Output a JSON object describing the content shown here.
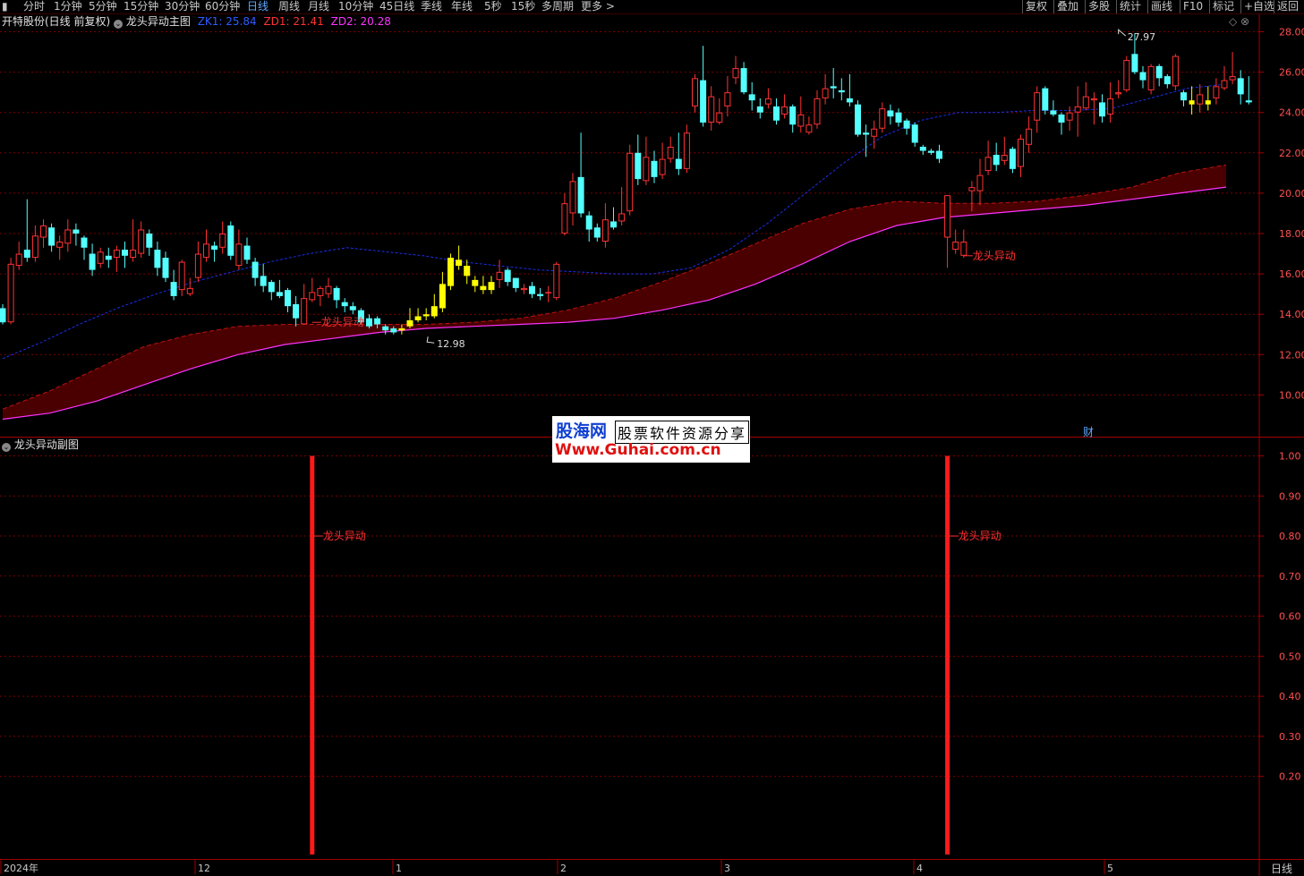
{
  "toolbar": {
    "periods": [
      "分时",
      "1分钟",
      "5分钟",
      "15分钟",
      "30分钟",
      "60分钟",
      "日线",
      "周线",
      "月线",
      "10分钟",
      "45日线",
      "季线",
      "年线",
      "5秒",
      "15秒",
      "多周期",
      "更多 >"
    ],
    "active_period": "日线",
    "right_buttons": [
      "复权",
      "叠加",
      "多股",
      "统计",
      "画线",
      "F10",
      "标记",
      "+自选",
      "返回"
    ]
  },
  "main_panel": {
    "stock_label": "开特股份(日线 前复权)",
    "indicator_name": "龙头异动主图",
    "zk1_label": "ZK1: 25.84",
    "zd1_label": "ZD1: 21.41",
    "zd2_label": "ZD2: 20.28",
    "high_annotation": "27.97",
    "low_annotation": "12.98",
    "signal_label": "龙头异动",
    "finance_marker": "财"
  },
  "sub_panel": {
    "indicator_name": "龙头异动副图",
    "signal_label": "龙头异动"
  },
  "watermark": {
    "site_cn": "股海网",
    "slogan": "股票软件资源分享",
    "url": "Www.Guhai.com.cn"
  },
  "x_axis": {
    "labels": [
      "2024年",
      "12",
      "1",
      "2",
      "3",
      "4",
      "5"
    ],
    "period_label": "日线"
  },
  "colors": {
    "up": "#ff3232",
    "down": "#54ffff",
    "signal": "#ffff00",
    "ma_line": "#1a2ee8",
    "band_fill": "#4a0000",
    "band_lower": "#ff33ff",
    "grid": "#7a0000",
    "signal_bar": "#ff1a1a"
  },
  "chart_data": [
    {
      "type": "candlestick",
      "title": "龙头异动主图",
      "ylim": [
        8.5,
        28.5
      ],
      "y_ticks": [
        "28.00",
        "26.00",
        "24.00",
        "22.00",
        "20.00",
        "18.00",
        "16.00",
        "14.00",
        "12.00",
        "10.00"
      ],
      "candles": [
        [
          14.3,
          13.6,
          14.5,
          13.5
        ],
        [
          13.6,
          16.5,
          16.8,
          13.5
        ],
        [
          16.4,
          17.0,
          17.6,
          16.2
        ],
        [
          17.2,
          16.8,
          19.7,
          16.6
        ],
        [
          16.8,
          17.9,
          18.4,
          16.6
        ],
        [
          17.8,
          18.4,
          18.7,
          17.3
        ],
        [
          18.3,
          17.4,
          18.5,
          17.1
        ],
        [
          17.3,
          17.6,
          17.9,
          16.7
        ],
        [
          17.5,
          18.2,
          18.7,
          17.1
        ],
        [
          18.2,
          18.0,
          18.5,
          17.4
        ],
        [
          17.8,
          17.3,
          17.9,
          16.7
        ],
        [
          17.0,
          16.2,
          17.5,
          15.9
        ],
        [
          16.5,
          17.1,
          17.3,
          16.3
        ],
        [
          16.9,
          16.7,
          17.3,
          16.3
        ],
        [
          16.8,
          17.2,
          17.4,
          16.1
        ],
        [
          17.2,
          16.9,
          17.6,
          16.3
        ],
        [
          16.8,
          17.2,
          18.7,
          16.6
        ],
        [
          17.0,
          18.2,
          18.6,
          16.8
        ],
        [
          18.0,
          17.3,
          18.2,
          16.9
        ],
        [
          17.2,
          16.3,
          17.6,
          15.9
        ],
        [
          16.8,
          15.8,
          17.1,
          15.6
        ],
        [
          15.6,
          14.9,
          16.2,
          14.7
        ],
        [
          15.2,
          16.6,
          16.7,
          14.9
        ],
        [
          15.0,
          15.3,
          15.8,
          14.9
        ],
        [
          15.8,
          17.0,
          17.6,
          15.6
        ],
        [
          16.8,
          17.5,
          18.2,
          16.6
        ],
        [
          17.4,
          17.2,
          17.6,
          16.6
        ],
        [
          17.3,
          18.0,
          18.6,
          17.0
        ],
        [
          18.4,
          16.9,
          18.6,
          16.7
        ],
        [
          16.4,
          17.5,
          18.2,
          16.2
        ],
        [
          17.4,
          16.7,
          17.8,
          16.5
        ],
        [
          16.6,
          15.8,
          16.8,
          15.4
        ],
        [
          15.9,
          15.4,
          16.5,
          15.1
        ],
        [
          15.6,
          15.1,
          15.7,
          14.7
        ],
        [
          15.1,
          14.9,
          15.7,
          14.8
        ],
        [
          15.2,
          14.4,
          15.3,
          14.1
        ],
        [
          14.5,
          13.8,
          14.9,
          13.4
        ],
        [
          13.5,
          14.8,
          15.5,
          13.5
        ],
        [
          14.7,
          15.1,
          15.8,
          14.6
        ],
        [
          14.9,
          15.3,
          15.4,
          14.4
        ],
        [
          15.0,
          15.4,
          15.8,
          14.8
        ],
        [
          15.3,
          14.7,
          15.4,
          14.3
        ],
        [
          14.6,
          14.4,
          14.8,
          14.1
        ],
        [
          14.4,
          14.2,
          14.6,
          14.0
        ],
        [
          14.2,
          13.6,
          14.3,
          13.5
        ],
        [
          13.8,
          13.4,
          14.0,
          13.3
        ],
        [
          13.8,
          13.5,
          13.9,
          13.3
        ],
        [
          13.4,
          13.2,
          13.5,
          13.0
        ],
        [
          13.3,
          13.1,
          13.4,
          13.0
        ],
        [
          13.2,
          13.3,
          13.5,
          13.0
        ],
        [
          13.4,
          13.7,
          14.3,
          13.3
        ],
        [
          13.7,
          13.9,
          14.3,
          13.6
        ],
        [
          13.9,
          14.0,
          14.3,
          13.7
        ],
        [
          13.9,
          14.4,
          15.0,
          13.8
        ],
        [
          14.3,
          15.5,
          16.1,
          14.1
        ],
        [
          15.4,
          16.8,
          17.0,
          15.2
        ],
        [
          16.7,
          16.4,
          17.4,
          16.2
        ],
        [
          16.4,
          15.9,
          16.7,
          15.5
        ],
        [
          15.7,
          15.4,
          15.9,
          15.1
        ],
        [
          15.4,
          15.2,
          15.9,
          15.0
        ],
        [
          15.2,
          15.6,
          15.9,
          15.0
        ],
        [
          15.7,
          16.1,
          16.7,
          15.3
        ],
        [
          16.2,
          15.6,
          16.3,
          15.4
        ],
        [
          15.8,
          15.3,
          15.8,
          15.1
        ],
        [
          15.2,
          15.3,
          15.5,
          15.0
        ],
        [
          15.4,
          15.0,
          15.6,
          14.8
        ],
        [
          15.0,
          14.9,
          15.3,
          14.7
        ],
        [
          15.1,
          15.1,
          15.4,
          14.6
        ],
        [
          14.8,
          16.5,
          16.6,
          14.7
        ],
        [
          18.0,
          19.5,
          20.0,
          17.9
        ],
        [
          19.0,
          20.6,
          21.0,
          18.4
        ],
        [
          20.8,
          19.0,
          23.0,
          18.8
        ],
        [
          18.9,
          18.2,
          19.1,
          17.6
        ],
        [
          18.3,
          17.8,
          18.5,
          17.6
        ],
        [
          17.6,
          18.7,
          19.5,
          17.3
        ],
        [
          18.6,
          18.3,
          19.3,
          18.2
        ],
        [
          18.6,
          19.0,
          20.3,
          18.4
        ],
        [
          19.1,
          22.0,
          22.4,
          18.9
        ],
        [
          22.0,
          20.7,
          22.9,
          20.4
        ],
        [
          20.6,
          21.8,
          22.8,
          20.4
        ],
        [
          21.6,
          20.8,
          22.1,
          20.5
        ],
        [
          20.9,
          21.7,
          22.5,
          20.7
        ],
        [
          21.7,
          22.3,
          22.8,
          21.5
        ],
        [
          21.7,
          21.2,
          23.0,
          20.9
        ],
        [
          21.2,
          23.0,
          23.4,
          21.0
        ],
        [
          24.3,
          25.7,
          25.9,
          24.0
        ],
        [
          25.6,
          23.5,
          27.3,
          23.3
        ],
        [
          23.5,
          24.8,
          25.3,
          23.1
        ],
        [
          23.5,
          24.0,
          24.7,
          23.4
        ],
        [
          24.3,
          25.0,
          25.8,
          23.8
        ],
        [
          25.7,
          26.2,
          26.8,
          25.4
        ],
        [
          26.2,
          25.0,
          26.5,
          24.9
        ],
        [
          24.9,
          24.6,
          25.5,
          24.1
        ],
        [
          24.3,
          24.0,
          24.7,
          23.7
        ],
        [
          24.4,
          24.7,
          25.2,
          24.2
        ],
        [
          24.3,
          23.6,
          24.7,
          23.4
        ],
        [
          23.9,
          24.3,
          24.9,
          23.7
        ],
        [
          24.3,
          23.4,
          24.4,
          23.0
        ],
        [
          23.3,
          23.9,
          24.8,
          23.0
        ],
        [
          23.0,
          23.4,
          23.8,
          22.9
        ],
        [
          23.4,
          24.7,
          25.1,
          23.2
        ],
        [
          24.7,
          25.2,
          25.9,
          24.4
        ],
        [
          25.3,
          25.2,
          26.2,
          24.7
        ],
        [
          25.1,
          25.0,
          25.7,
          24.6
        ],
        [
          24.7,
          24.5,
          25.9,
          24.3
        ],
        [
          24.4,
          22.9,
          24.6,
          22.8
        ],
        [
          23.0,
          22.9,
          23.4,
          21.8
        ],
        [
          22.8,
          23.2,
          23.6,
          22.2
        ],
        [
          23.2,
          24.2,
          24.5,
          23.0
        ],
        [
          24.1,
          23.8,
          24.4,
          23.4
        ],
        [
          24.0,
          23.5,
          24.2,
          23.3
        ],
        [
          23.6,
          23.2,
          23.7,
          22.9
        ],
        [
          23.4,
          22.5,
          23.5,
          22.3
        ],
        [
          22.3,
          22.1,
          22.4,
          21.9
        ],
        [
          22.1,
          22.0,
          22.2,
          21.9
        ],
        [
          22.1,
          21.7,
          22.4,
          21.5
        ],
        [
          17.8,
          19.9,
          19.9,
          16.3
        ],
        [
          17.2,
          17.6,
          18.2,
          17.0
        ],
        [
          16.9,
          17.6,
          18.2,
          16.8
        ],
        [
          20.1,
          20.3,
          20.6,
          19.1
        ],
        [
          20.1,
          20.9,
          21.7,
          19.4
        ],
        [
          21.1,
          21.8,
          22.6,
          20.9
        ],
        [
          21.9,
          21.4,
          22.5,
          21.1
        ],
        [
          21.6,
          21.9,
          22.8,
          21.4
        ],
        [
          22.2,
          21.2,
          22.3,
          21.0
        ],
        [
          21.3,
          22.7,
          22.9,
          20.8
        ],
        [
          22.4,
          23.2,
          23.8,
          22.0
        ],
        [
          23.6,
          25.0,
          25.3,
          23.0
        ],
        [
          25.2,
          24.1,
          25.3,
          23.9
        ],
        [
          24.1,
          23.9,
          24.6,
          23.8
        ],
        [
          23.9,
          23.5,
          24.0,
          22.9
        ],
        [
          23.6,
          24.0,
          24.3,
          23.1
        ],
        [
          24.0,
          24.3,
          25.3,
          22.8
        ],
        [
          24.2,
          24.8,
          25.5,
          24.1
        ],
        [
          24.6,
          24.7,
          25.0,
          23.4
        ],
        [
          24.5,
          23.8,
          24.9,
          23.5
        ],
        [
          23.9,
          24.7,
          25.5,
          23.5
        ],
        [
          24.9,
          25.0,
          25.6,
          24.7
        ],
        [
          25.1,
          26.6,
          26.8,
          25.0
        ],
        [
          26.9,
          26.0,
          27.9,
          25.9
        ],
        [
          26.0,
          25.6,
          26.3,
          25.2
        ],
        [
          25.1,
          26.3,
          26.4,
          24.9
        ],
        [
          26.3,
          25.7,
          26.4,
          25.3
        ],
        [
          25.8,
          25.4,
          25.9,
          25.2
        ],
        [
          25.3,
          26.8,
          26.9,
          25.1
        ],
        [
          25.0,
          24.6,
          25.1,
          24.3
        ],
        [
          24.4,
          24.6,
          25.3,
          23.9
        ],
        [
          24.4,
          24.9,
          25.4,
          24.0
        ],
        [
          24.4,
          24.6,
          25.3,
          24.1
        ],
        [
          24.7,
          25.3,
          25.7,
          24.4
        ],
        [
          25.2,
          25.6,
          26.3,
          25.1
        ],
        [
          25.6,
          25.8,
          27.0,
          25.4
        ],
        [
          25.7,
          24.9,
          26.1,
          24.4
        ],
        [
          24.6,
          24.5,
          25.8,
          24.4
        ]
      ],
      "signal_candles": [
        49,
        50,
        51,
        52,
        53,
        54,
        55,
        56,
        57,
        58,
        59,
        60,
        146,
        148
      ],
      "ma_line": [
        11.8,
        12.6,
        13.5,
        14.3,
        15.0,
        15.6,
        16.1,
        16.6,
        17.0,
        17.3,
        17.1,
        16.9,
        16.6,
        16.4,
        16.2,
        16.1,
        16.0,
        16.0,
        16.3,
        17.2,
        18.5,
        20.0,
        21.5,
        22.8,
        23.6,
        24.0,
        24.0,
        24.1,
        24.1,
        24.2,
        24.7,
        25.2,
        25.4
      ],
      "band_upper": [
        9.3,
        10.2,
        11.3,
        12.4,
        13.0,
        13.4,
        13.5,
        13.5,
        13.5,
        13.5,
        13.6,
        13.8,
        14.2,
        14.8,
        15.6,
        16.5,
        17.5,
        18.5,
        19.2,
        19.6,
        19.5,
        19.5,
        19.6,
        19.9,
        20.3,
        21.0,
        21.4
      ],
      "band_lower": [
        8.8,
        9.1,
        9.7,
        10.5,
        11.3,
        12.0,
        12.5,
        12.8,
        13.1,
        13.3,
        13.4,
        13.5,
        13.6,
        13.8,
        14.2,
        14.7,
        15.5,
        16.5,
        17.6,
        18.4,
        18.8,
        19.0,
        19.2,
        19.4,
        19.7,
        20.0,
        20.3
      ],
      "annotations": [
        {
          "label": "27.97",
          "value": 27.97
        },
        {
          "label": "12.98",
          "value": 12.98
        }
      ]
    },
    {
      "type": "bar",
      "title": "龙头异动副图",
      "ylim": [
        0,
        1.04
      ],
      "y_ticks": [
        "1.00",
        "0.90",
        "0.80",
        "0.70",
        "0.60",
        "0.50",
        "0.40",
        "0.30",
        "0.20"
      ],
      "signals": [
        {
          "value": 1.0,
          "label": "龙头异动"
        },
        {
          "value": 1.0,
          "label": "龙头异动"
        }
      ]
    }
  ]
}
